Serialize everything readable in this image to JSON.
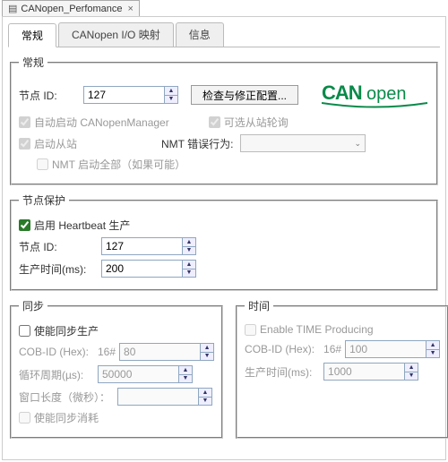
{
  "window": {
    "title": "CANopen_Perfomance",
    "close": "×"
  },
  "tabs": {
    "general": "常规",
    "io": "CANopen I/O 映射",
    "info": "信息"
  },
  "general_group": {
    "legend": "常规",
    "node_id_label": "节点 ID:",
    "node_id_value": "127",
    "check_config_btn": "检查与修正配置...",
    "auto_start_manager": "自动启动 CANopenManager",
    "optional_slave_poll": "可选从站轮询",
    "start_slave": "启动从站",
    "nmt_error_label": "NMT 错误行为:",
    "nmt_start_all": "NMT 启动全部（如果可能）"
  },
  "node_guard": {
    "legend": "节点保护",
    "enable_heartbeat": "启用 Heartbeat 生产",
    "node_id_label": "节点 ID:",
    "node_id_value": "127",
    "produce_time_label": "生产时间(ms):",
    "produce_time_value": "200"
  },
  "sync": {
    "legend": "同步",
    "enable_sync": "使能同步生产",
    "cobid_label": "COB-ID (Hex):",
    "hex_prefix": "16#",
    "cobid_value": "80",
    "cycle_label": "循环周期(µs):",
    "cycle_value": "50000",
    "window_label": "窗口长度（微秒）：",
    "window_value": "",
    "enable_consume": "使能同步消耗"
  },
  "time": {
    "legend": "时间",
    "enable_time": "Enable TIME Producing",
    "cobid_label": "COB-ID (Hex):",
    "hex_prefix": "16#",
    "cobid_value": "100",
    "produce_time_label": "生产时间(ms):",
    "produce_time_value": "1000"
  },
  "logo": {
    "can": "CAN",
    "open": "open"
  }
}
